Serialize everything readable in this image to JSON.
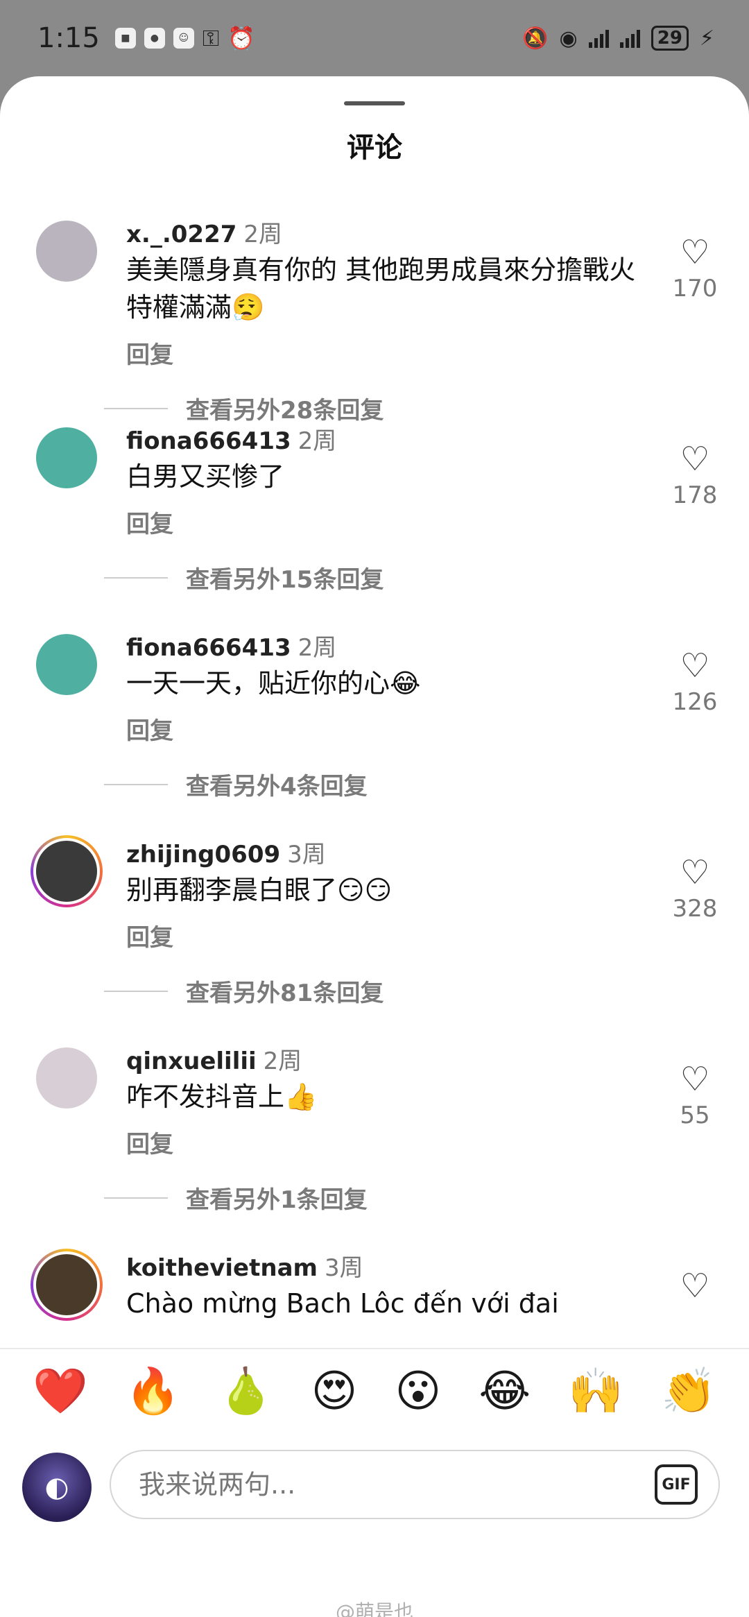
{
  "status_bar": {
    "time": "1:15",
    "battery": "29"
  },
  "sheet": {
    "title": "评论"
  },
  "comments": [
    {
      "username": "x._.0227",
      "time": "2周",
      "text": "美美隱身真有你的 其他跑男成員來分擔戰火 特權滿滿😮‍💨",
      "reply_label": "回复",
      "likes": "170",
      "more_replies": "查看另外28条回复",
      "avatar_color": "#b9b4bd",
      "story_ring": false
    },
    {
      "username": "fiona666413",
      "time": "2周",
      "text": "白男又买惨了",
      "reply_label": "回复",
      "likes": "178",
      "more_replies": "查看另外15条回复",
      "avatar_color": "#4fb0a2",
      "story_ring": false
    },
    {
      "username": "fiona666413",
      "time": "2周",
      "text": "一天一天，贴近你的心😂",
      "reply_label": "回复",
      "likes": "126",
      "more_replies": "查看另外4条回复",
      "avatar_color": "#4fb0a2",
      "story_ring": false
    },
    {
      "username": "zhijing0609",
      "time": "3周",
      "text": "别再翻李晨白眼了😏😏",
      "reply_label": "回复",
      "likes": "328",
      "more_replies": "查看另外81条回复",
      "avatar_color": "#3a3a3a",
      "story_ring": true
    },
    {
      "username": "qinxuelilii",
      "time": "2周",
      "text": "咋不发抖音上👍",
      "reply_label": "回复",
      "likes": "55",
      "more_replies": "查看另外1条回复",
      "avatar_color": "#d8cfd6",
      "story_ring": false
    },
    {
      "username": "koithevietnam",
      "time": "3周",
      "text": "Chào mừng Bach Lôc đến với đai",
      "reply_label": "",
      "likes": "",
      "more_replies": "",
      "avatar_color": "#4a3a2a",
      "story_ring": true
    }
  ],
  "emoji_bar": [
    "❤️",
    "🔥",
    "🍐",
    "😍",
    "😮",
    "😂",
    "🙌",
    "👏"
  ],
  "composer": {
    "placeholder": "我来说两句...",
    "gif_label": "GIF"
  },
  "watermark": "@萌是也"
}
